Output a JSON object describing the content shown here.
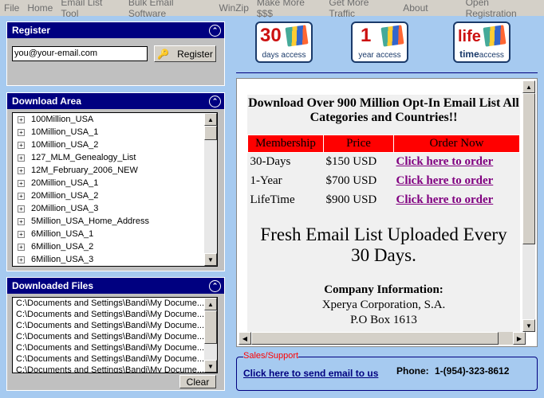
{
  "menu": [
    "File",
    "Home",
    "Email List Tool",
    "Bulk Email Software",
    "WinZip",
    "Make More $$$",
    "Get More Traffic",
    "About",
    "Open Registration"
  ],
  "register": {
    "title": "Register",
    "email_value": "you@your-email.com",
    "button": "Register"
  },
  "download_area": {
    "title": "Download Area",
    "items": [
      "100Million_USA",
      "10Million_USA_1",
      "10Million_USA_2",
      "127_MLM_Genealogy_List",
      "12M_February_2006_NEW",
      "20Million_USA_1",
      "20Million_USA_2",
      "20Million_USA_3",
      "5Million_USA_Home_Address",
      "6Million_USA_1",
      "6Million_USA_2",
      "6Million_USA_3"
    ]
  },
  "downloaded_files": {
    "title": "Downloaded Files",
    "items": [
      "C:\\Documents and Settings\\Bandi\\My Docume...",
      "C:\\Documents and Settings\\Bandi\\My Docume...",
      "C:\\Documents and Settings\\Bandi\\My Docume...",
      "C:\\Documents and Settings\\Bandi\\My Docume...",
      "C:\\Documents and Settings\\Bandi\\My Docume...",
      "C:\\Documents and Settings\\Bandi\\My Docume...",
      "C:\\Documents and Settings\\Bandi\\My Docume..."
    ],
    "clear": "Clear"
  },
  "badges": [
    {
      "big": "30",
      "sub": "days access"
    },
    {
      "big": "1",
      "sub": "year access"
    },
    {
      "big": "life",
      "sub_bold": "time",
      "sub": "access"
    }
  ],
  "doc": {
    "headline": "Download Over 900 Million Opt-In Email List All Categories and Countries!!",
    "columns": [
      "Membership",
      "Price",
      "Order Now"
    ],
    "rows": [
      {
        "m": "30-Days",
        "p": "$150 USD",
        "o": "Click here to order"
      },
      {
        "m": "1-Year",
        "p": "$700 USD",
        "o": "Click here to order"
      },
      {
        "m": "LifeTime",
        "p": "$900 USD",
        "o": "Click here to order"
      }
    ],
    "fresh": "Fresh Email List Uploaded Every 30 Days.",
    "company_title": "Company Information:",
    "company_name": "Xperya Corporation, S.A.",
    "company_addr": "P.O Box 1613"
  },
  "support": {
    "legend": "Sales/Support",
    "link": "Click here to send email to us",
    "phone_label": "Phone:",
    "phone": "1-(954)-323-8612"
  },
  "colors": {
    "header": "#000080",
    "background": "#a6caf0",
    "table_header": "#ff0000",
    "link": "#800080"
  }
}
